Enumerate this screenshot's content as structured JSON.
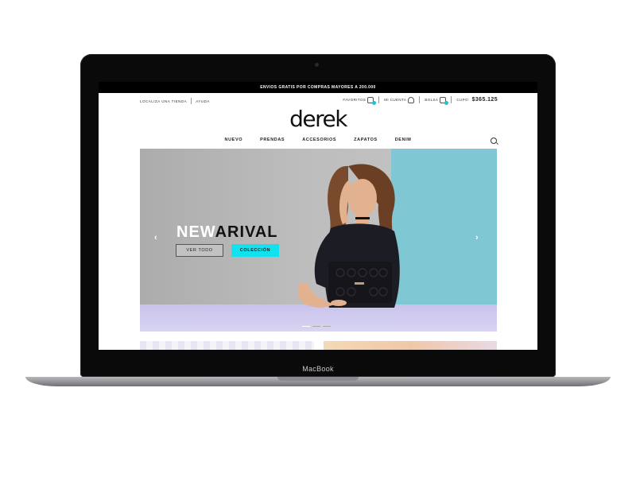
{
  "device": {
    "brand_label": "MacBook"
  },
  "site": {
    "promo_text": "ENVIOS GRATIS POR COMPRAS MAYORES A 200.000",
    "logo_text": "derek",
    "util_left": [
      "LOCALIZA UNA TIENDA",
      "AYUDA"
    ],
    "util_right": {
      "favoritos": "FAVORITOS",
      "mi_cuenta": "MI CUENTA",
      "bolsa": "BOLSA",
      "cupo_label": "CUPO:",
      "cupo_value": "$365.125"
    },
    "nav": [
      "NUEVO",
      "PRENDAS",
      "ACCESORIOS",
      "ZAPATOS",
      "DENIM"
    ]
  },
  "hero": {
    "headline_light": "NEW",
    "headline_dark": "ARIVAL",
    "btn_ver": "VER TODO",
    "btn_coleccion": "COLECCIÓN",
    "prev_arrow": "‹",
    "next_arrow": "›"
  },
  "colors": {
    "accent": "#12e1ee",
    "badge": "#19c6d0",
    "hero_right": "#7fc7d3",
    "hero_floor": "#c9c3ec"
  }
}
